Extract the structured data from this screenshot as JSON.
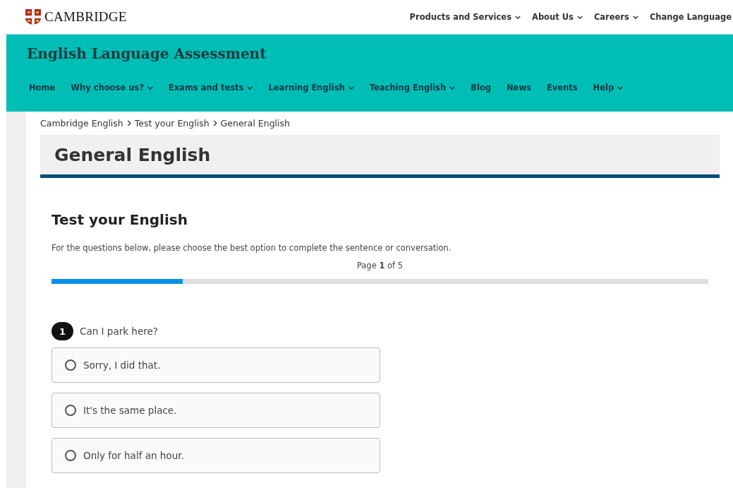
{
  "header": {
    "logo_text": "CAMBRIDGE",
    "links": [
      {
        "label": "Products and Services",
        "dropdown": true
      },
      {
        "label": "About Us",
        "dropdown": true
      },
      {
        "label": "Careers",
        "dropdown": true
      },
      {
        "label": "Change Language",
        "dropdown": false
      }
    ]
  },
  "banner": {
    "title": "English Language Assessment",
    "nav": [
      {
        "label": "Home",
        "dropdown": false
      },
      {
        "label": "Why choose us?",
        "dropdown": true
      },
      {
        "label": "Exams and tests",
        "dropdown": true
      },
      {
        "label": "Learning English",
        "dropdown": true
      },
      {
        "label": "Teaching English",
        "dropdown": true
      },
      {
        "label": "Blog",
        "dropdown": false
      },
      {
        "label": "News",
        "dropdown": false
      },
      {
        "label": "Events",
        "dropdown": false
      },
      {
        "label": "Help",
        "dropdown": true
      }
    ]
  },
  "breadcrumb": [
    "Cambridge English",
    "Test your English",
    "General English"
  ],
  "page_title": "General English",
  "test": {
    "heading": "Test your English",
    "instructions": "For the questions below, please choose the best option to complete the sentence or conversation.",
    "page_indicator": "Page **1** of 5",
    "progress": {
      "level": 0.2
    },
    "questions": [
      {
        "number": "1",
        "text": "Can I park here?",
        "options": [
          {
            "label": "Sorry, I did that.",
            "selected": false
          },
          {
            "label": "It's the same place.",
            "selected": false
          },
          {
            "label": "Only for half an hour.",
            "selected": false
          }
        ]
      }
    ]
  }
}
